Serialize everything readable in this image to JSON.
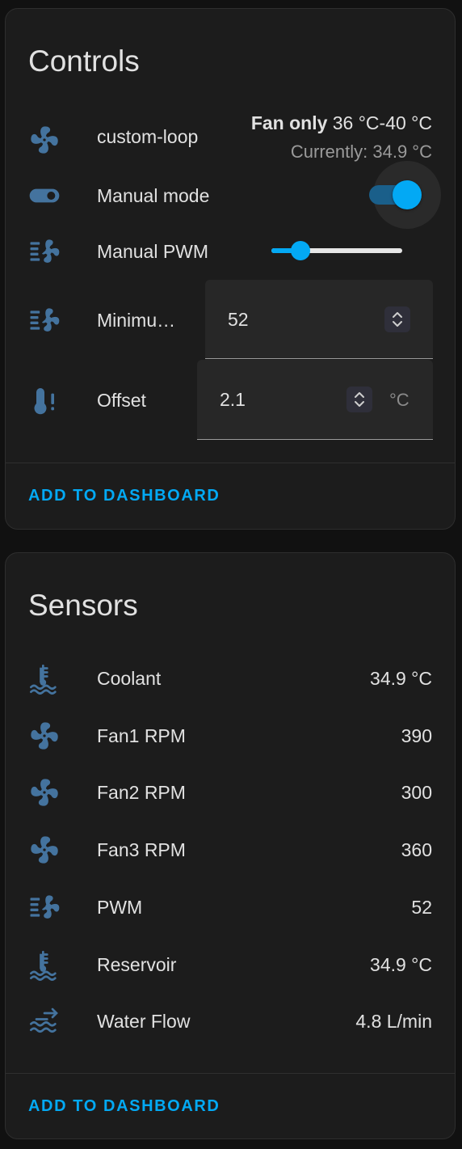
{
  "controls": {
    "title": "Controls",
    "climate": {
      "name": "custom-loop",
      "mode": "Fan only",
      "range": "36 °C-40 °C",
      "current": "Currently: 34.9 °C"
    },
    "manual_mode": {
      "label": "Manual mode",
      "on": true
    },
    "manual_pwm": {
      "label": "Manual PWM",
      "level_fraction": 0.22
    },
    "minimum": {
      "label": "Minimu…",
      "value": "52"
    },
    "offset": {
      "label": "Offset",
      "value": "2.1",
      "unit": "°C"
    },
    "add_label": "ADD TO DASHBOARD"
  },
  "sensors": {
    "title": "Sensors",
    "items": [
      {
        "label": "Coolant",
        "value": "34.9 °C",
        "icon": "coolant-temperature-icon"
      },
      {
        "label": "Fan1 RPM",
        "value": "390",
        "icon": "fan-icon"
      },
      {
        "label": "Fan2 RPM",
        "value": "300",
        "icon": "fan-icon"
      },
      {
        "label": "Fan3 RPM",
        "value": "360",
        "icon": "fan-icon"
      },
      {
        "label": "PWM",
        "value": "52",
        "icon": "fan-speed-icon"
      },
      {
        "label": "Reservoir",
        "value": "34.9 °C",
        "icon": "coolant-temperature-icon"
      },
      {
        "label": "Water Flow",
        "value": "4.8 L/min",
        "icon": "water-flow-icon"
      }
    ],
    "add_label": "ADD TO DASHBOARD"
  },
  "colors": {
    "accent": "#03a9f4",
    "icon": "#44739e",
    "card": "#1c1c1c",
    "background": "#111111"
  }
}
